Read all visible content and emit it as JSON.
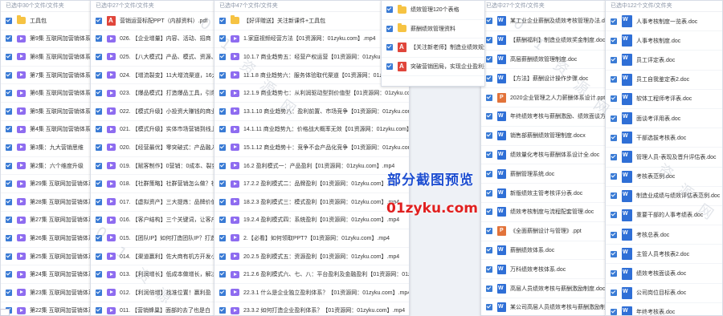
{
  "overlay": {
    "title": "部分截图预览",
    "url": "01zyku.com"
  },
  "watermark_text": [
    "0",
    "1",
    "资",
    "源",
    "网"
  ],
  "panels": [
    {
      "header": "已选中30个文件/文件夹",
      "items": [
        {
          "icon": "folder-icon",
          "label": "工具包"
        },
        {
          "icon": "video-icon",
          "label": "第9集 互联网加营销体系"
        },
        {
          "icon": "video-icon",
          "label": "第8集 互联网加营销体系"
        },
        {
          "icon": "video-icon",
          "label": "第7集 互联网加营销体系"
        },
        {
          "icon": "video-icon",
          "label": "第6集 互联网加营销体系"
        },
        {
          "icon": "video-icon",
          "label": "第5集 互联网加营销体系"
        },
        {
          "icon": "video-icon",
          "label": "第4集 互联网加营销体系"
        },
        {
          "icon": "video-icon",
          "label": "第3集：九大营销思维"
        },
        {
          "icon": "video-icon",
          "label": "第2集：六个维度升级"
        },
        {
          "icon": "video-icon",
          "label": "第29集 互联网加营销体系"
        },
        {
          "icon": "video-icon",
          "label": "第28集 互联网加营销体系"
        },
        {
          "icon": "video-icon",
          "label": "第27集 互联网加营销体系"
        },
        {
          "icon": "video-icon",
          "label": "第26集 互联网加营销体系"
        },
        {
          "icon": "video-icon",
          "label": "第25集 互联网加营销体系"
        },
        {
          "icon": "video-icon",
          "label": "第24集 互联网加营销体系"
        },
        {
          "icon": "video-icon",
          "label": "第23集 互联网加营销体系"
        },
        {
          "icon": "video-icon",
          "label": "第22集 互联网加营销体系"
        }
      ]
    },
    {
      "header": "已选中27个文件/文件夹",
      "items": [
        {
          "icon": "pdf-icon",
          "label": "营销运营标配PPT（内部资料）.pdf"
        },
        {
          "icon": "video-icon",
          "label": "026. 【企业增量】内容、活动、招商"
        },
        {
          "icon": "video-icon",
          "label": "025. 【八大模式】产品、模式、资源、平台"
        },
        {
          "icon": "video-icon",
          "label": "024. 【增流裂变】11大增流渠道，16大裂变"
        },
        {
          "icon": "video-icon",
          "label": "023. 【爆品模式】打造爆品工具，引爆销售"
        },
        {
          "icon": "video-icon",
          "label": "022. 【模式升级】小投资大赚钱的商业模式"
        },
        {
          "icon": "video-icon",
          "label": "021. 【模式升级】实体市场营销到线上"
        },
        {
          "icon": "video-icon",
          "label": "020. 【经营最优】零突破式：产品融入场景"
        },
        {
          "icon": "video-icon",
          "label": "019. 【赋客制作】0营销：0成本、裂变"
        },
        {
          "icon": "video-icon",
          "label": "018. 【社群策略】社群营销怎么做？社群"
        },
        {
          "icon": "video-icon",
          "label": "017. 【虚拟资产】三大提炼：品牌价值"
        },
        {
          "icon": "video-icon",
          "label": "016. 【客户结构】三个关键词，让客户主动"
        },
        {
          "icon": "video-icon",
          "label": "015. 【团队IP】如何打造团队IP？打造"
        },
        {
          "icon": "video-icon",
          "label": "014. 【渠道赢利】佐大商有机方开发小店"
        },
        {
          "icon": "video-icon",
          "label": "013. 【利润增长】低成本做增长，解决"
        },
        {
          "icon": "video-icon",
          "label": "012. 【利润倍增】找准位置！赢利盈"
        },
        {
          "icon": "video-icon",
          "label": "011. 【营销蜂巢】面部的去了也是白"
        }
      ]
    },
    {
      "header": "已选中47个文件/文件夹",
      "items": [
        {
          "icon": "folder-icon",
          "label": "【好评赠送】关注新课件+工具包"
        },
        {
          "icon": "video-icon",
          "label": "1.家庭视频经营方法【01资源网：01zyku.com】.mp4"
        },
        {
          "icon": "video-icon",
          "label": "10.1.7 商业趋势五：经营产权运营【01资源网：01zyku.com】.mp4"
        },
        {
          "icon": "video-icon",
          "label": "11.1.8 商业趋势六：服务体验取代渠道【01资源网：01zyku.com】.mp4"
        },
        {
          "icon": "video-icon",
          "label": "12.1.9 商业趋势七：从利润驱动型到价值型【01资源网：01zyku.com】.mp4"
        },
        {
          "icon": "video-icon",
          "label": "13.1.10 商业趋势八：盈利前置、市场竞争【01资源网：01zyku.com】.mp4"
        },
        {
          "icon": "video-icon",
          "label": "14.1.11 商业趋势九：价格战大概率无效【01资源网：01zyku.com】.mp4"
        },
        {
          "icon": "video-icon",
          "label": "15.1.12 商业趋势十：竞争不会产品化竞争【01资源网：01zyku.com】.mp4"
        },
        {
          "icon": "video-icon",
          "label": "16.2 盈利模式一：产品盈利【01资源网：01zyku.com】.mp4"
        },
        {
          "icon": "video-icon",
          "label": "17.2.2 盈利模式二：品牌盈利【01资源网：01zyku.com】.mp4"
        },
        {
          "icon": "video-icon",
          "label": "18.2.3 盈利模式三：模式盈利【01资源网：01zyku.com】.mp4"
        },
        {
          "icon": "video-icon",
          "label": "19.2.4 盈利模式四：系统盈利【01资源网：01zyku.com】.mp4"
        },
        {
          "icon": "video-icon",
          "label": "2.【必看】如何领取PPT?【01资源网：01zyku.com】.mp4"
        },
        {
          "icon": "video-icon",
          "label": "20.2.5 盈利模式五：资源盈利【01资源网：01zyku.com】.mp4"
        },
        {
          "icon": "video-icon",
          "label": "21.2.6 盈利模式六、七、八：平台盈利及金融盈利【01资源网：01zyku.com】.mp4"
        },
        {
          "icon": "video-icon",
          "label": "22.3.1 什么是企业独立盈利体系？【01资源网：01zyku.com】.mp4"
        },
        {
          "icon": "video-icon",
          "label": "23.3.2 如何打造企业盈利体系？【01资源网：01zyku.com】.mp4"
        }
      ]
    },
    {
      "header": "",
      "items": [
        {
          "icon": "folder-icon",
          "label": "绩效管理120个表格"
        },
        {
          "icon": "folder-icon",
          "label": "薪酬绩效管理资料"
        },
        {
          "icon": "pdf-icon",
          "label": "【关注新老师】制造业绩效规划方案.pdf"
        },
        {
          "icon": "pdf-icon",
          "label": "突破营销困局，实现企业盈利无限增长.pdf"
        }
      ]
    },
    {
      "header": "已选中27个文件/文件夹",
      "items": [
        {
          "icon": "doc-icon",
          "label": "某工业企业薪酬及绩效考核管理办法.doc"
        },
        {
          "icon": "doc-icon",
          "label": "【薪酬福利】制造业绩效奖金制度.doc"
        },
        {
          "icon": "doc-icon",
          "label": "高层薪酬绩效管理制度.doc"
        },
        {
          "icon": "doc-icon",
          "label": "【方法】薪酬设计操作步骤.doc"
        },
        {
          "icon": "ppt-icon",
          "label": "2020企业管理之人力薪酬体系设计.ppt"
        },
        {
          "icon": "doc-icon",
          "label": "年终绩效考核与薪酬激励、绩效面谈方案.doc"
        },
        {
          "icon": "doc-icon",
          "label": "销售部薪酬绩效管理制度.docx"
        },
        {
          "icon": "doc-icon",
          "label": "绩效量化考核与薪酬体系设计全.doc"
        },
        {
          "icon": "doc-icon",
          "label": "薪酬管理系统.doc"
        },
        {
          "icon": "doc-icon",
          "label": "新版绩效主管考核评分表.doc"
        },
        {
          "icon": "doc-icon",
          "label": "绩效考核制度与流程配套管理.doc"
        },
        {
          "icon": "ppt-icon",
          "label": "《全面薪酬设计与管理》.ppt"
        },
        {
          "icon": "doc-icon",
          "label": "薪酬绩效体系.doc"
        },
        {
          "icon": "doc-icon",
          "label": "万科绩效考核体系.doc"
        },
        {
          "icon": "doc-icon",
          "label": "高层人员绩效考核与薪酬激励制度.doc"
        },
        {
          "icon": "doc-icon",
          "label": "某公司高层人员绩效考核与薪酬激励制度.doc"
        }
      ]
    },
    {
      "header": "已选中122个文件/文件夹",
      "items": [
        {
          "icon": "doc-icon",
          "label": "人事考核制度一览表.doc"
        },
        {
          "icon": "doc-icon",
          "label": "人事考核制度.doc"
        },
        {
          "icon": "doc-icon",
          "label": "员工评定表.doc"
        },
        {
          "icon": "doc-icon",
          "label": "员工自我鉴定表2.doc"
        },
        {
          "icon": "doc-icon",
          "label": "软体工程师考评表.doc"
        },
        {
          "icon": "doc-icon",
          "label": "面谈考评用表.doc"
        },
        {
          "icon": "doc-icon",
          "label": "干部选拔考核表.doc"
        },
        {
          "icon": "doc-icon",
          "label": "管理人员-表现及晋升评估表.doc"
        },
        {
          "icon": "doc-icon",
          "label": "考核表范例.doc"
        },
        {
          "icon": "doc-icon",
          "label": "制造业成绩与绩效评估表范例.doc"
        },
        {
          "icon": "doc-icon",
          "label": "重要干部的人事考绩表.doc"
        },
        {
          "icon": "doc-icon",
          "label": "考核总表.doc"
        },
        {
          "icon": "doc-icon",
          "label": "主管人员考核表2.doc"
        },
        {
          "icon": "doc-icon",
          "label": "绩效考核面谈表.doc"
        },
        {
          "icon": "doc-icon",
          "label": "公司岗位目标表.doc"
        },
        {
          "icon": "doc-icon",
          "label": "年终考核表.doc"
        }
      ]
    }
  ]
}
